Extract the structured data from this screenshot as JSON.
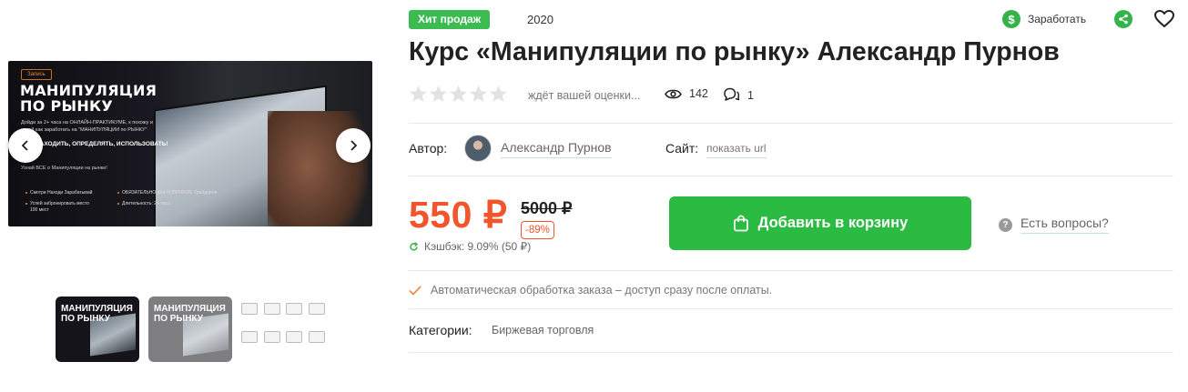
{
  "gallery": {
    "hero_tag": "Запись",
    "hero_title": "МАНИПУЛЯЦИЯ ПО РЫНКУ",
    "hero_subtitle": "Дойди за 2+ часа на ОНЛАЙН-ПРАКТИКУМЕ, к похожу и узнай как заработать на \"МАНИПУЛЯЦИИ по РЫНКУ\"",
    "hero_callout": "НАХОДИТЬ, ОПРЕДЕЛЯТЬ, ИСПОЛЬЗОВАТЬ!",
    "hero_want": "Узнай ВСЕ о Манипуляции на рынке!",
    "hero_features": [
      "Смотри Находи Зарабатывай",
      "Успей забронировать место 100 мест",
      "ОБЯЗАТЕЛЬНО для НОВИЧКОВ, Трейдеров",
      "Длительность: 2+ часа"
    ],
    "thumb_title": "МАНИПУЛЯЦИЯ ПО РЫНКУ"
  },
  "badge": "Хит продаж",
  "year": "2020",
  "earn_label": "Заработать",
  "title": "Курс «Манипуляции по рынку» Александр Пурнов",
  "rating": {
    "stars": 0,
    "max": 5,
    "text": "ждёт вашей оценки..."
  },
  "views": "142",
  "comments": "1",
  "author": {
    "label": "Автор:",
    "name": "Александр Пурнов"
  },
  "site": {
    "label": "Сайт:",
    "link": "показать url"
  },
  "price": {
    "current": "550 ₽",
    "old": "5000 ₽",
    "discount": "-89%",
    "cashback": "Кэшбэк: 9.09% (50 ₽)"
  },
  "cart_button": "Добавить в корзину",
  "questions_link": "Есть вопросы?",
  "auto_note": "Автоматическая обработка заказа – доступ сразу после оплаты.",
  "categories": {
    "label": "Категории:",
    "items": [
      "Биржевая торговля"
    ]
  },
  "colors": {
    "accent": "#2cbb42",
    "price": "#f2552c",
    "badge": "#3dbb53"
  }
}
